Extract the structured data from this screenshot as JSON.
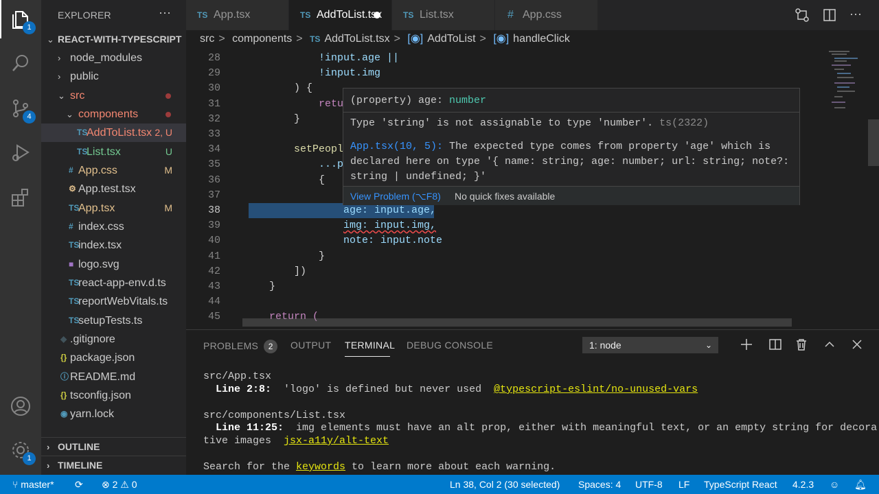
{
  "activity_bar": {
    "explorer_badge": "1",
    "scm_badge": "4",
    "settings_badge": "1"
  },
  "explorer": {
    "title": "EXPLORER",
    "more": "···",
    "project": "REACT-WITH-TYPESCRIPT",
    "items": [
      {
        "label": "node_modules",
        "type": "folder",
        "status": ""
      },
      {
        "label": "public",
        "type": "folder",
        "status": ""
      },
      {
        "label": "src",
        "type": "folder-open",
        "status": ""
      },
      {
        "label": "components",
        "type": "folder-open",
        "status": ""
      },
      {
        "label": "AddToList.tsx",
        "type": "ts",
        "status": "2, U"
      },
      {
        "label": "List.tsx",
        "type": "ts",
        "status": "U"
      },
      {
        "label": "App.css",
        "type": "css",
        "status": "M"
      },
      {
        "label": "App.test.tsx",
        "type": "test",
        "status": ""
      },
      {
        "label": "App.tsx",
        "type": "ts",
        "status": "M"
      },
      {
        "label": "index.css",
        "type": "css",
        "status": ""
      },
      {
        "label": "index.tsx",
        "type": "ts",
        "status": ""
      },
      {
        "label": "logo.svg",
        "type": "svg",
        "status": ""
      },
      {
        "label": "react-app-env.d.ts",
        "type": "ts",
        "status": ""
      },
      {
        "label": "reportWebVitals.ts",
        "type": "ts",
        "status": ""
      },
      {
        "label": "setupTests.ts",
        "type": "ts",
        "status": ""
      },
      {
        "label": ".gitignore",
        "type": "git",
        "status": ""
      },
      {
        "label": "package.json",
        "type": "json",
        "status": ""
      },
      {
        "label": "README.md",
        "type": "md",
        "status": ""
      },
      {
        "label": "tsconfig.json",
        "type": "json",
        "status": ""
      },
      {
        "label": "yarn.lock",
        "type": "yarn",
        "status": ""
      }
    ],
    "outline": "OUTLINE",
    "timeline": "TIMELINE"
  },
  "tabs": [
    {
      "label": "App.tsx",
      "icon": "TS"
    },
    {
      "label": "AddToList.tsx",
      "icon": "TS"
    },
    {
      "label": "List.tsx",
      "icon": "TS"
    },
    {
      "label": "App.css",
      "icon": "#"
    }
  ],
  "breadcrumbs": {
    "seg1": "src",
    "seg2": "components",
    "seg3": "AddToList.tsx",
    "seg4": "AddToList",
    "seg5": "handleClick",
    "ts": "TS",
    "sep": ">"
  },
  "editor": {
    "lines": [
      {
        "num": "28",
        "text": "!input.age ||"
      },
      {
        "num": "29",
        "text": "!input.img"
      },
      {
        "num": "30",
        "text": ") {"
      },
      {
        "num": "31",
        "text": "retu"
      },
      {
        "num": "32",
        "text": "}"
      },
      {
        "num": "33",
        "text": ""
      },
      {
        "num": "34",
        "text": "setPeopl"
      },
      {
        "num": "35",
        "text": "...p"
      },
      {
        "num": "36",
        "text": "{"
      },
      {
        "num": "37",
        "text": ""
      },
      {
        "num": "38",
        "text": "age: input.age,"
      },
      {
        "num": "39",
        "text": "img: input.img,"
      },
      {
        "num": "40",
        "text": "note: input.note"
      },
      {
        "num": "41",
        "text": "}"
      },
      {
        "num": "42",
        "text": "])"
      },
      {
        "num": "43",
        "text": "}"
      },
      {
        "num": "44",
        "text": ""
      },
      {
        "num": "45",
        "text": "return ("
      }
    ]
  },
  "hover": {
    "signature_prefix": "(property) age: ",
    "signature_type": "number",
    "message": "Type 'string' is not assignable to type 'number'.",
    "code": "ts(2322)",
    "related_link": "App.tsx(10, 5):",
    "related_text": "The expected type comes from property 'age' which is declared here on type '{ name: string; age: number; url: string; note?: string | undefined; }'",
    "view_problem": "View Problem (⌥F8)",
    "no_fixes": "No quick fixes available"
  },
  "panel": {
    "tabs": {
      "problems": "PROBLEMS",
      "problems_count": "2",
      "output": "OUTPUT",
      "terminal": "TERMINAL",
      "debug": "DEBUG CONSOLE"
    },
    "terminal_select": "1: node",
    "terminal": {
      "l1": "src/App.tsx",
      "l2_loc": "  Line 2:8:",
      "l2_msg": "  'logo' is defined but never used  ",
      "l2_rule": "@typescript-eslint/no-unused-vars",
      "l3": "src/components/List.tsx",
      "l4_loc": "  Line 11:25:",
      "l4_msg": "  img elements must have an alt prop, either with meaningful text, or an empty string for decora",
      "l5_msg": "tive images  ",
      "l5_rule": "jsx-a11y/alt-text",
      "l6_pre": "Search for the ",
      "l6_link": "keywords",
      "l6_post": " to learn more about each warning."
    }
  },
  "status_bar": {
    "branch": "master*",
    "errors": "2",
    "warnings": "0",
    "position": "Ln 38, Col 2 (30 selected)",
    "spaces": "Spaces: 4",
    "encoding": "UTF-8",
    "eol": "LF",
    "language": "TypeScript React",
    "version": "4.2.3"
  },
  "colors": {
    "accent": "#007acc",
    "badge": "#0e70c0",
    "modified": "#e2c08d",
    "untracked": "#73c991",
    "error": "#f14c4c"
  }
}
